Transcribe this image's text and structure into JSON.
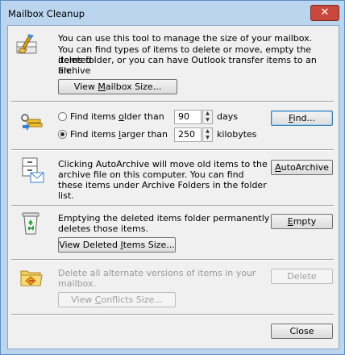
{
  "window": {
    "title": "Mailbox Cleanup",
    "close_glyph": "✕"
  },
  "intro": {
    "line1": "You can use this tool to manage the size of your mailbox.",
    "line2a": "You can find types of items to delete or move, empty the deleted",
    "line2b": "items folder, or you can have Outlook transfer items to an archive",
    "line2c": "file.",
    "view_button_pre": "View ",
    "view_button_u": "M",
    "view_button_post": "ailbox Size..."
  },
  "find": {
    "older_pre": "Find items ",
    "older_u": "o",
    "older_post": "lder than",
    "older_value": "90",
    "older_unit": "days",
    "larger_pre": "Find items ",
    "larger_u": "l",
    "larger_post": "arger than",
    "larger_value": "250",
    "larger_unit": "kilobytes",
    "selected": "larger",
    "button_u": "F",
    "button_post": "ind..."
  },
  "archive": {
    "line1": "Clicking AutoArchive will move old items to the",
    "line2": "archive file on this computer. You can find",
    "line3": "these items under Archive Folders in the folder",
    "line4": "list.",
    "button_u": "A",
    "button_post": "utoArchive"
  },
  "deleted": {
    "line1": "Emptying the deleted items folder permanently",
    "line2": "deletes those items.",
    "empty_u": "E",
    "empty_post": "mpty",
    "view_pre": "View Deleted ",
    "view_u": "I",
    "view_post": "tems Size..."
  },
  "conflicts": {
    "line1": "Delete all alternate versions of items in your",
    "line2": "mailbox.",
    "delete_label": "Delete",
    "view_pre": "View ",
    "view_u": "C",
    "view_post": "onflicts Size..."
  },
  "footer": {
    "close_label": "Close"
  }
}
